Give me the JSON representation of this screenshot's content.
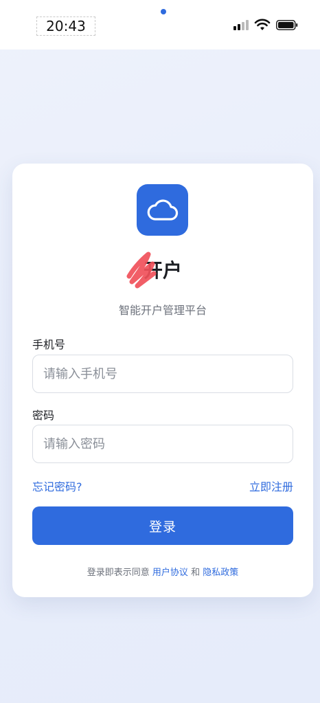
{
  "status_bar": {
    "time": "20:43",
    "icons": [
      "signal-icon",
      "wifi-icon",
      "battery-icon"
    ]
  },
  "brand": {
    "logo_icon": "cloud-icon",
    "title": "开户",
    "subtitle": "智能开户管理平台",
    "color": "#2f6bde"
  },
  "form": {
    "phone_label": "手机号",
    "phone_placeholder": "请输入手机号",
    "phone_value": "",
    "password_label": "密码",
    "password_placeholder": "请输入密码",
    "password_value": ""
  },
  "links": {
    "forgot": "忘记密码?",
    "register": "立即注册"
  },
  "login_button": "登录",
  "terms": {
    "prefix": "登录即表示同意",
    "user_agreement": "用户协议",
    "and": "和",
    "privacy_policy": "隐私政策"
  }
}
